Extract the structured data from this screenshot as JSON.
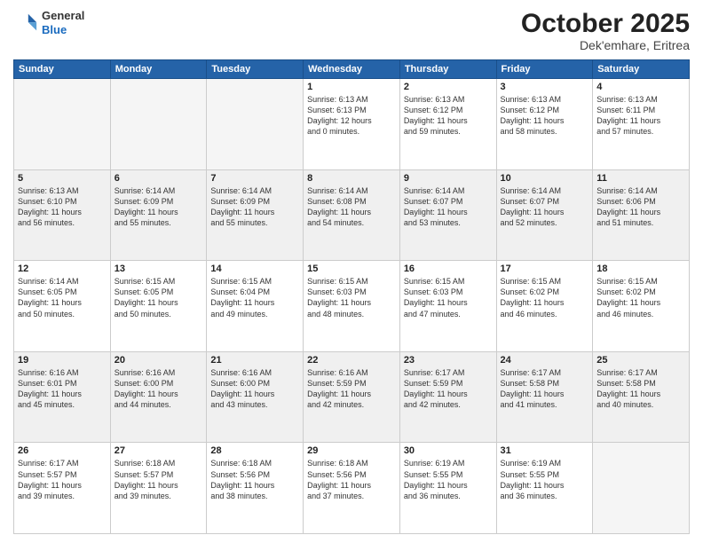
{
  "header": {
    "logo_line1": "General",
    "logo_line2": "Blue",
    "month": "October 2025",
    "location": "Dek'emhare, Eritrea"
  },
  "weekdays": [
    "Sunday",
    "Monday",
    "Tuesday",
    "Wednesday",
    "Thursday",
    "Friday",
    "Saturday"
  ],
  "weeks": [
    [
      {
        "day": "",
        "info": ""
      },
      {
        "day": "",
        "info": ""
      },
      {
        "day": "",
        "info": ""
      },
      {
        "day": "1",
        "info": "Sunrise: 6:13 AM\nSunset: 6:13 PM\nDaylight: 12 hours\nand 0 minutes."
      },
      {
        "day": "2",
        "info": "Sunrise: 6:13 AM\nSunset: 6:12 PM\nDaylight: 11 hours\nand 59 minutes."
      },
      {
        "day": "3",
        "info": "Sunrise: 6:13 AM\nSunset: 6:12 PM\nDaylight: 11 hours\nand 58 minutes."
      },
      {
        "day": "4",
        "info": "Sunrise: 6:13 AM\nSunset: 6:11 PM\nDaylight: 11 hours\nand 57 minutes."
      }
    ],
    [
      {
        "day": "5",
        "info": "Sunrise: 6:13 AM\nSunset: 6:10 PM\nDaylight: 11 hours\nand 56 minutes."
      },
      {
        "day": "6",
        "info": "Sunrise: 6:14 AM\nSunset: 6:09 PM\nDaylight: 11 hours\nand 55 minutes."
      },
      {
        "day": "7",
        "info": "Sunrise: 6:14 AM\nSunset: 6:09 PM\nDaylight: 11 hours\nand 55 minutes."
      },
      {
        "day": "8",
        "info": "Sunrise: 6:14 AM\nSunset: 6:08 PM\nDaylight: 11 hours\nand 54 minutes."
      },
      {
        "day": "9",
        "info": "Sunrise: 6:14 AM\nSunset: 6:07 PM\nDaylight: 11 hours\nand 53 minutes."
      },
      {
        "day": "10",
        "info": "Sunrise: 6:14 AM\nSunset: 6:07 PM\nDaylight: 11 hours\nand 52 minutes."
      },
      {
        "day": "11",
        "info": "Sunrise: 6:14 AM\nSunset: 6:06 PM\nDaylight: 11 hours\nand 51 minutes."
      }
    ],
    [
      {
        "day": "12",
        "info": "Sunrise: 6:14 AM\nSunset: 6:05 PM\nDaylight: 11 hours\nand 50 minutes."
      },
      {
        "day": "13",
        "info": "Sunrise: 6:15 AM\nSunset: 6:05 PM\nDaylight: 11 hours\nand 50 minutes."
      },
      {
        "day": "14",
        "info": "Sunrise: 6:15 AM\nSunset: 6:04 PM\nDaylight: 11 hours\nand 49 minutes."
      },
      {
        "day": "15",
        "info": "Sunrise: 6:15 AM\nSunset: 6:03 PM\nDaylight: 11 hours\nand 48 minutes."
      },
      {
        "day": "16",
        "info": "Sunrise: 6:15 AM\nSunset: 6:03 PM\nDaylight: 11 hours\nand 47 minutes."
      },
      {
        "day": "17",
        "info": "Sunrise: 6:15 AM\nSunset: 6:02 PM\nDaylight: 11 hours\nand 46 minutes."
      },
      {
        "day": "18",
        "info": "Sunrise: 6:15 AM\nSunset: 6:02 PM\nDaylight: 11 hours\nand 46 minutes."
      }
    ],
    [
      {
        "day": "19",
        "info": "Sunrise: 6:16 AM\nSunset: 6:01 PM\nDaylight: 11 hours\nand 45 minutes."
      },
      {
        "day": "20",
        "info": "Sunrise: 6:16 AM\nSunset: 6:00 PM\nDaylight: 11 hours\nand 44 minutes."
      },
      {
        "day": "21",
        "info": "Sunrise: 6:16 AM\nSunset: 6:00 PM\nDaylight: 11 hours\nand 43 minutes."
      },
      {
        "day": "22",
        "info": "Sunrise: 6:16 AM\nSunset: 5:59 PM\nDaylight: 11 hours\nand 42 minutes."
      },
      {
        "day": "23",
        "info": "Sunrise: 6:17 AM\nSunset: 5:59 PM\nDaylight: 11 hours\nand 42 minutes."
      },
      {
        "day": "24",
        "info": "Sunrise: 6:17 AM\nSunset: 5:58 PM\nDaylight: 11 hours\nand 41 minutes."
      },
      {
        "day": "25",
        "info": "Sunrise: 6:17 AM\nSunset: 5:58 PM\nDaylight: 11 hours\nand 40 minutes."
      }
    ],
    [
      {
        "day": "26",
        "info": "Sunrise: 6:17 AM\nSunset: 5:57 PM\nDaylight: 11 hours\nand 39 minutes."
      },
      {
        "day": "27",
        "info": "Sunrise: 6:18 AM\nSunset: 5:57 PM\nDaylight: 11 hours\nand 39 minutes."
      },
      {
        "day": "28",
        "info": "Sunrise: 6:18 AM\nSunset: 5:56 PM\nDaylight: 11 hours\nand 38 minutes."
      },
      {
        "day": "29",
        "info": "Sunrise: 6:18 AM\nSunset: 5:56 PM\nDaylight: 11 hours\nand 37 minutes."
      },
      {
        "day": "30",
        "info": "Sunrise: 6:19 AM\nSunset: 5:55 PM\nDaylight: 11 hours\nand 36 minutes."
      },
      {
        "day": "31",
        "info": "Sunrise: 6:19 AM\nSunset: 5:55 PM\nDaylight: 11 hours\nand 36 minutes."
      },
      {
        "day": "",
        "info": ""
      }
    ]
  ]
}
